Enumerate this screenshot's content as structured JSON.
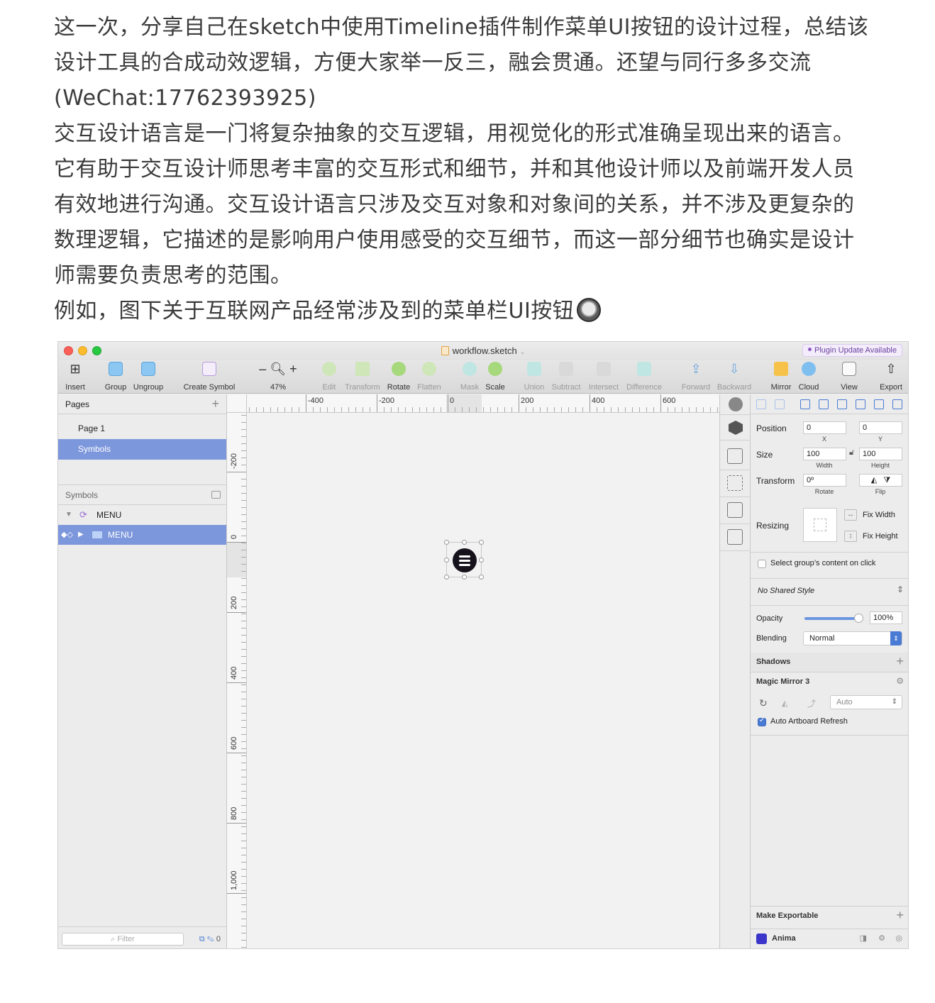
{
  "article": {
    "p1_line1": "这一次，分享自己在sketch中使用Timeline插件制作菜单UI按钮的设计过程，总结该",
    "p1_line2": "设计工具的合成动效逻辑，方便大家举一反三，融会贯通。还望与同行多多交流",
    "p1_line3": "(WeChat:17762393925)",
    "p2_line1": "交互设计语言是一门将复杂抽象的交互逻辑，用视觉化的形式准确呈现出来的语言。",
    "p2_line2": "它有助于交互设计师思考丰富的交互形式和细节，并和其他设计师以及前端开发人员",
    "p2_line3": "有效地进行沟通。交互设计语言只涉及交互对象和对象间的关系，并不涉及更复杂的",
    "p2_line4": "数理逻辑，它描述的是影响用户使用感受的交互细节，而这一部分细节也确实是设计",
    "p2_line5": "师需要负责思考的范围。",
    "p3_line1": "例如，图下关于互联网产品经常涉及到的菜单栏UI按钮"
  },
  "window": {
    "title": "workflow.sketch",
    "plugin_badge": "Plugin Update Available"
  },
  "toolbar": {
    "insert": "Insert",
    "group": "Group",
    "ungroup": "Ungroup",
    "create_symbol": "Create Symbol",
    "zoom": "47%",
    "edit": "Edit",
    "transform": "Transform",
    "rotate": "Rotate",
    "flatten": "Flatten",
    "mask": "Mask",
    "scale": "Scale",
    "union": "Union",
    "subtract": "Subtract",
    "intersect": "Intersect",
    "difference": "Difference",
    "forward": "Forward",
    "backward": "Backward",
    "mirror": "Mirror",
    "cloud": "Cloud",
    "view": "View",
    "export": "Export"
  },
  "left_panel": {
    "pages_header": "Pages",
    "pages": [
      "Page 1",
      "Symbols"
    ],
    "symbols_header": "Symbols",
    "layers": [
      "MENU",
      "MENU"
    ],
    "filter_placeholder": "Filter",
    "filter_count": "0"
  },
  "rulers": {
    "horizontal": [
      "-400",
      "-200",
      "0",
      "200",
      "400",
      "600"
    ],
    "vertical": [
      "-200",
      "0",
      "200",
      "400",
      "600",
      "800",
      "1,000"
    ]
  },
  "inspector": {
    "position_label": "Position",
    "x": "0",
    "y": "0",
    "x_label": "X",
    "y_label": "Y",
    "size_label": "Size",
    "width": "100",
    "height": "100",
    "width_label": "Width",
    "height_label": "Height",
    "transform_label": "Transform",
    "rotate_value": "0º",
    "rotate_label": "Rotate",
    "flip_label": "Flip",
    "resizing_label": "Resizing",
    "fix_width": "Fix Width",
    "fix_height": "Fix Height",
    "select_group_content": "Select group’s content on click",
    "shared_style": "No Shared Style",
    "opacity_label": "Opacity",
    "opacity_value": "100%",
    "opacity": 1.0,
    "blending_label": "Blending",
    "blending_value": "Normal",
    "shadows_label": "Shadows",
    "magic_mirror_label": "Magic Mirror 3",
    "magic_mirror_mode": "Auto",
    "auto_artboard_refresh": "Auto Artboard Refresh",
    "make_exportable": "Make Exportable",
    "anima": "Anima"
  },
  "colors": {
    "selection_blue": "#7d97dc",
    "accent_blue": "#4a7bd4",
    "menu_button": "#16121c"
  }
}
